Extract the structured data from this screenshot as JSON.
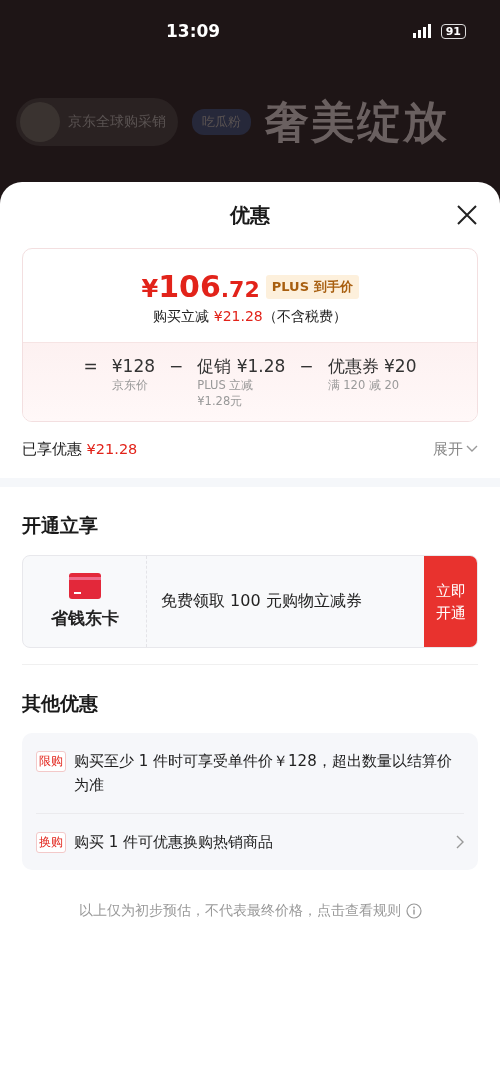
{
  "status_bar": {
    "time": "13:09",
    "battery": "91"
  },
  "backdrop": {
    "host_name": "京东全球购采销",
    "fan_tag": "吃瓜粉",
    "banner_title": "奢美绽放"
  },
  "sheet": {
    "title": "优惠",
    "price_card": {
      "price_symbol": "¥",
      "price_int": "106",
      "price_dec": ".72",
      "price_tag": "PLUS 到手价",
      "saving_label": "购买立减",
      "saving_amount": "¥21.28",
      "saving_note": "（不含税费）",
      "breakdown": [
        {
          "kind": "operator",
          "symbol": "="
        },
        {
          "kind": "term",
          "value": "¥128",
          "caption": "京东价"
        },
        {
          "kind": "operator",
          "symbol": "−"
        },
        {
          "kind": "term",
          "value": "促销 ¥1.28",
          "caption": "PLUS 立减\n¥1.28元"
        },
        {
          "kind": "operator",
          "symbol": "−"
        },
        {
          "kind": "term",
          "value": "优惠券 ¥20",
          "caption": "满 120 减 20"
        }
      ]
    },
    "enjoyed": {
      "label": "已享优惠",
      "amount": "¥21.28",
      "toggle": "展开",
      "expanded": false
    },
    "open_section": {
      "title": "开通立享",
      "card_name": "省钱东卡",
      "offer": "免费领取 100 元购物立减券",
      "button": [
        "立即",
        "开通"
      ]
    },
    "other_section": {
      "title": "其他优惠",
      "items": [
        {
          "tag": "限购",
          "text": "购买至少 1 件时可享受单件价￥128，超出数量以结算价为准",
          "has_arrow": false
        },
        {
          "tag": "换购",
          "text": "购买 1 件可优惠换购热销商品",
          "has_arrow": true
        }
      ]
    },
    "footnote": "以上仅为初步预估，不代表最终价格，点击查看规则"
  }
}
